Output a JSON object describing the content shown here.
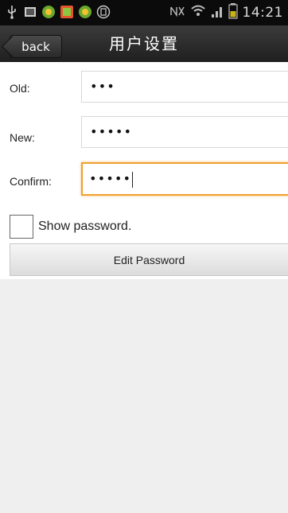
{
  "status_bar": {
    "time": "14:21",
    "left_icons": [
      "usb-icon",
      "image-icon",
      "app-icon-1",
      "app-icon-2",
      "app-icon-3",
      "trash-icon"
    ],
    "right_icons": [
      "nfc-icon",
      "wifi-icon",
      "signal-icon",
      "battery-icon"
    ]
  },
  "header": {
    "back_label": "back",
    "title": "用户设置"
  },
  "form": {
    "old_label": "Old:",
    "old_value": "•••",
    "new_label": "New:",
    "new_value": "•••••",
    "confirm_label": "Confirm:",
    "confirm_value": "•••••",
    "show_password_label": "Show password.",
    "show_password_checked": false,
    "submit_label": "Edit Password"
  },
  "colors": {
    "header_bg": "#2b2b2b",
    "focus_border": "#f0a030",
    "body_bg": "#efefef"
  }
}
